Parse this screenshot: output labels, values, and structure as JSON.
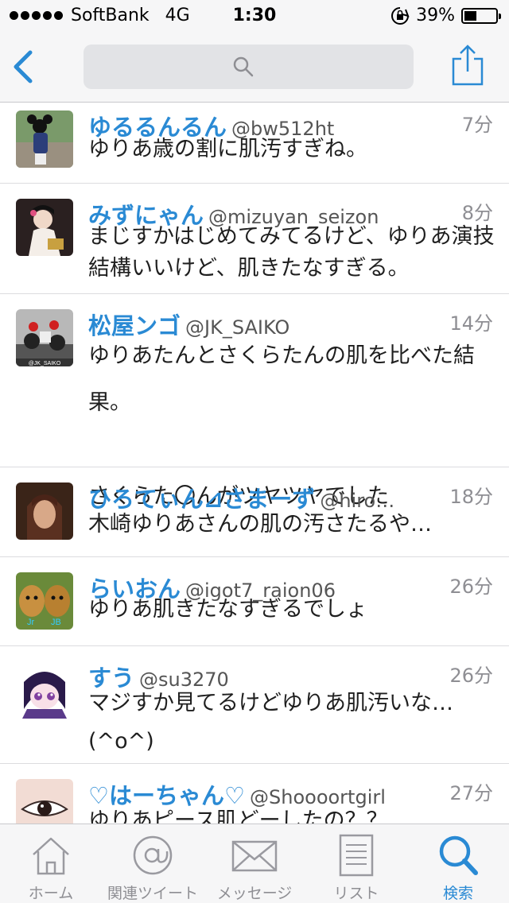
{
  "status_bar": {
    "carrier": "SoftBank",
    "network": "4G",
    "time": "1:30",
    "battery_percent": "39%",
    "battery_level": 0.39
  },
  "nav": {
    "back_icon": "chevron-left-icon",
    "search_icon": "search-icon",
    "share_icon": "share-icon",
    "accent_color": "#2a8ad4"
  },
  "tweets": [
    {
      "name": "ゆるるんるん",
      "handle": "@bw512ht",
      "time": "7分",
      "text": "ゆりあ歳の割に肌汚すぎね。"
    },
    {
      "name": "みずにゃん",
      "handle": "@mizuyan_seizon",
      "time": "8分",
      "text": "まじすかはじめてみてるけど、ゆりあ演技結構いいけど、肌きたなすぎる。"
    },
    {
      "name": "松屋ンゴ",
      "handle": "@JK_SAIKO",
      "time": "14分",
      "text": "ゆりあたんとさくらたんの肌を比べた結果。\n\nさくらた〇んがツヤツヤでした",
      "avatar_text": "@JK_SAIKO"
    },
    {
      "name": "ひろてぃん⊿さまーず",
      "handle": "@hiro…",
      "time": "18分",
      "text": "木崎ゆりあさんの肌の汚さたるや…"
    },
    {
      "name": "らいおん",
      "handle": "@igot7_raion06",
      "time": "26分",
      "text": "ゆりあ肌きたなすぎるでしょ",
      "avatar_labels": [
        "Jr",
        "JB"
      ]
    },
    {
      "name": "すう",
      "handle": "@su3270",
      "time": "26分",
      "text": "マジすか見てるけどゆりあ肌汚いな…\n(^o^)"
    },
    {
      "name": "♡はーちゃん♡",
      "handle": "@Shoooortgirl",
      "time": "27分",
      "text": "ゆりあピース肌どーしたの？？"
    }
  ],
  "tabs": [
    {
      "label": "ホーム",
      "icon": "home-icon",
      "active": false
    },
    {
      "label": "関連ツイート",
      "icon": "at-icon",
      "active": false
    },
    {
      "label": "メッセージ",
      "icon": "envelope-icon",
      "active": false
    },
    {
      "label": "リスト",
      "icon": "list-icon",
      "active": false
    },
    {
      "label": "検索",
      "icon": "search-icon",
      "active": true
    }
  ]
}
